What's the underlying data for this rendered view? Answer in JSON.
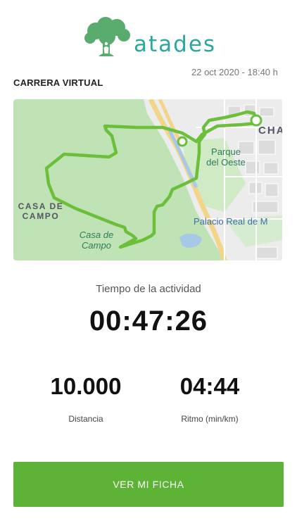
{
  "brand": {
    "name": "atades"
  },
  "header": {
    "datetime": "22 oct 2020 - 18:40 h",
    "section_title": "CARRERA VIRTUAL"
  },
  "map": {
    "labels": {
      "district": "CHA",
      "park_name": "Parque del Oeste",
      "palace": "Palacio Real de M",
      "casa_de_campo_caps": "CASA DE CAMPO",
      "casa_de_campo": "Casa de Campo"
    }
  },
  "activity": {
    "label": "Tiempo de la actividad",
    "time": "00:47:26"
  },
  "stats": {
    "distance": {
      "value": "10.000",
      "label": "Distancia"
    },
    "pace": {
      "value": "04:44",
      "label": "Ritmo (min/km)"
    }
  },
  "button": {
    "label": "VER MI FICHA"
  },
  "colors": {
    "accent": "#5cb335",
    "brand_teal": "#2aa8a0",
    "route": "#6bbf3a"
  }
}
